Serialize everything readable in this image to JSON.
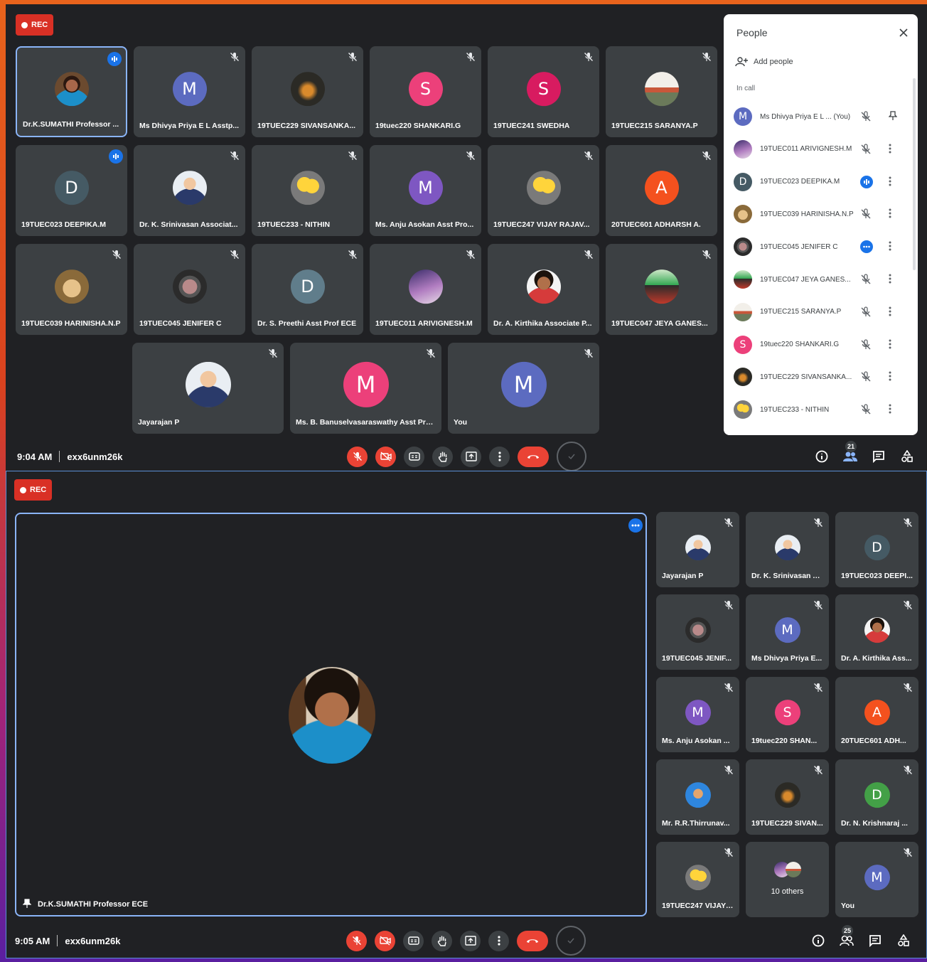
{
  "top": {
    "rec_label": "REC",
    "tiles": [
      {
        "name": "Dr.K.SUMATHI Professor ...",
        "letter": "",
        "photo": "photo-woman",
        "speaking": true
      },
      {
        "name": "Ms Dhivya Priya E L Asstp...",
        "letter": "M",
        "color": "#5c6bc0"
      },
      {
        "name": "19TUEC229 SIVANSANKA...",
        "letter": "",
        "photo": "photo-dark"
      },
      {
        "name": "19tuec220 SHANKARI.G",
        "letter": "S",
        "color": "#ec407a"
      },
      {
        "name": "19TUEC241 SWEDHA",
        "letter": "S",
        "color": "#d81b60"
      },
      {
        "name": "19TUEC215 SARANYA.P",
        "letter": "",
        "photo": "photo-sunset"
      },
      {
        "name": "19TUEC023 DEEPIKA.M",
        "letter": "D",
        "color": "#455a64",
        "speaking": true
      },
      {
        "name": "Dr. K. Srinivasan Associat...",
        "letter": "",
        "photo": "photo-person"
      },
      {
        "name": "19TUEC233 - NITHIN",
        "letter": "",
        "photo": "photo-minion"
      },
      {
        "name": "Ms. Anju Asokan Asst Pro...",
        "letter": "M",
        "color": "#7e57c2"
      },
      {
        "name": "19TUEC247 VIJAY RAJAV...",
        "letter": "",
        "photo": "photo-minion"
      },
      {
        "name": "20TUEC601 ADHARSH A.",
        "letter": "A",
        "color": "#f4511e"
      },
      {
        "name": "19TUEC039 HARINISHA.N.P",
        "letter": "",
        "photo": "photo-dog"
      },
      {
        "name": "19TUEC045 JENIFER C",
        "letter": "",
        "photo": "photo-ring"
      },
      {
        "name": "Dr. S. Preethi Asst Prof ECE",
        "letter": "D",
        "color": "#607d8b"
      },
      {
        "name": "19TUEC011 ARIVIGNESH.M",
        "letter": "",
        "photo": "photo-galaxy"
      },
      {
        "name": "Dr. A. Kirthika Associate P...",
        "letter": "",
        "photo": "photo-lady"
      },
      {
        "name": "19TUEC047 JEYA GANES...",
        "letter": "",
        "photo": "photo-green"
      },
      {
        "name": "Jayarajan P",
        "letter": "",
        "photo": "photo-person"
      },
      {
        "name": "Ms. B. Banuselvasaraswathy Asst Pro...",
        "letter": "M",
        "color": "#ec407a"
      },
      {
        "name": "You",
        "letter": "M",
        "color": "#5c6bc0"
      }
    ],
    "time": "9:04 AM",
    "meeting_code": "exx6unm26k",
    "people_count": "21",
    "people_panel": {
      "title": "People",
      "add_people": "Add people",
      "in_call": "In call",
      "rows": [
        {
          "name": "Ms Dhivya Priya E L ...  (You)",
          "letter": "M",
          "color": "#5c6bc0",
          "state": "muted",
          "action": "pin"
        },
        {
          "name": "19TUEC011 ARIVIGNESH.M",
          "letter": "",
          "photo": "photo-galaxy",
          "state": "muted",
          "action": "more"
        },
        {
          "name": "19TUEC023 DEEPIKA.M",
          "letter": "D",
          "color": "#455a64",
          "state": "speaking",
          "action": "more"
        },
        {
          "name": "19TUEC039 HARINISHA.N.P",
          "letter": "",
          "photo": "photo-dog",
          "state": "muted",
          "action": "more"
        },
        {
          "name": "19TUEC045 JENIFER C",
          "letter": "",
          "photo": "photo-ring",
          "state": "dots",
          "action": "more"
        },
        {
          "name": "19TUEC047 JEYA GANES...",
          "letter": "",
          "photo": "photo-green",
          "state": "muted",
          "action": "more"
        },
        {
          "name": "19TUEC215 SARANYA.P",
          "letter": "",
          "photo": "photo-sunset",
          "state": "muted",
          "action": "more"
        },
        {
          "name": "19tuec220 SHANKARI.G",
          "letter": "S",
          "color": "#ec407a",
          "state": "muted",
          "action": "more"
        },
        {
          "name": "19TUEC229 SIVANSANKA...",
          "letter": "",
          "photo": "photo-dark",
          "state": "muted",
          "action": "more"
        },
        {
          "name": "19TUEC233 - NITHIN",
          "letter": "",
          "photo": "photo-minion",
          "state": "muted",
          "action": "more"
        }
      ]
    }
  },
  "bottom": {
    "rec_label": "REC",
    "main_name": "Dr.K.SUMATHI Professor ECE",
    "tiles": [
      {
        "name": "Jayarajan P",
        "letter": "",
        "photo": "photo-person"
      },
      {
        "name": "Dr. K. Srinivasan A...",
        "letter": "",
        "photo": "photo-person"
      },
      {
        "name": "19TUEC023 DEEPI...",
        "letter": "D",
        "color": "#455a64"
      },
      {
        "name": "19TUEC045 JENIF...",
        "letter": "",
        "photo": "photo-ring"
      },
      {
        "name": "Ms Dhivya Priya E...",
        "letter": "M",
        "color": "#5c6bc0"
      },
      {
        "name": "Dr. A. Kirthika Ass...",
        "letter": "",
        "photo": "photo-lady"
      },
      {
        "name": "Ms. Anju Asokan ...",
        "letter": "M",
        "color": "#7e57c2"
      },
      {
        "name": "19tuec220 SHAN...",
        "letter": "S",
        "color": "#ec407a"
      },
      {
        "name": "20TUEC601 ADH...",
        "letter": "A",
        "color": "#f4511e"
      },
      {
        "name": "Mr. R.R.Thirrunav...",
        "letter": "",
        "photo": "photo-kid"
      },
      {
        "name": "19TUEC229 SIVAN...",
        "letter": "",
        "photo": "photo-dark"
      },
      {
        "name": "Dr. N. Krishnaraj ...",
        "letter": "D",
        "color": "#43a047"
      },
      {
        "name": "19TUEC247 VIJAY ...",
        "letter": "",
        "photo": "photo-minion"
      },
      {
        "name": "10 others",
        "letter": "",
        "others": true
      },
      {
        "name": "You",
        "letter": "M",
        "color": "#5c6bc0"
      }
    ],
    "time": "9:05 AM",
    "meeting_code": "exx6unm26k",
    "people_count": "25"
  }
}
